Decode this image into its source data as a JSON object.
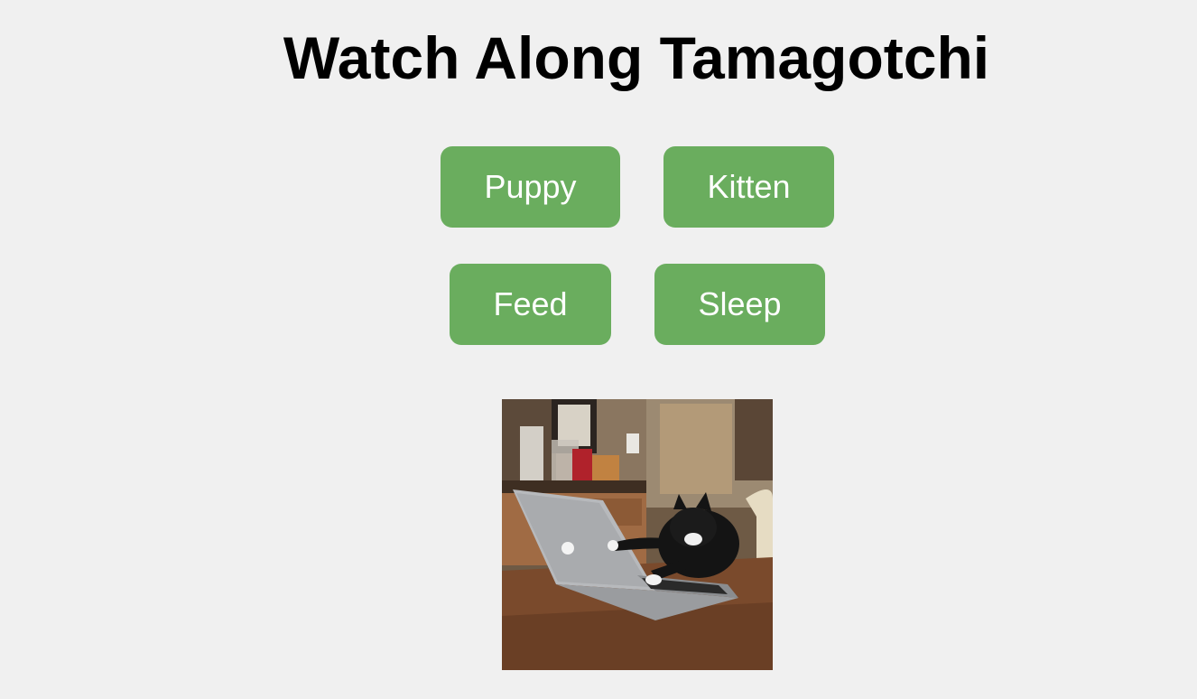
{
  "page": {
    "title": "Watch Along Tamagotchi"
  },
  "buttons": {
    "puppy": "Puppy",
    "kitten": "Kitten",
    "feed": "Feed",
    "sleep": "Sleep"
  },
  "pet_image": {
    "subject": "cat-typing-on-laptop"
  },
  "colors": {
    "background": "#f0f0f0",
    "button": "#6aad5e",
    "button_text": "#ffffff",
    "title": "#000000"
  }
}
